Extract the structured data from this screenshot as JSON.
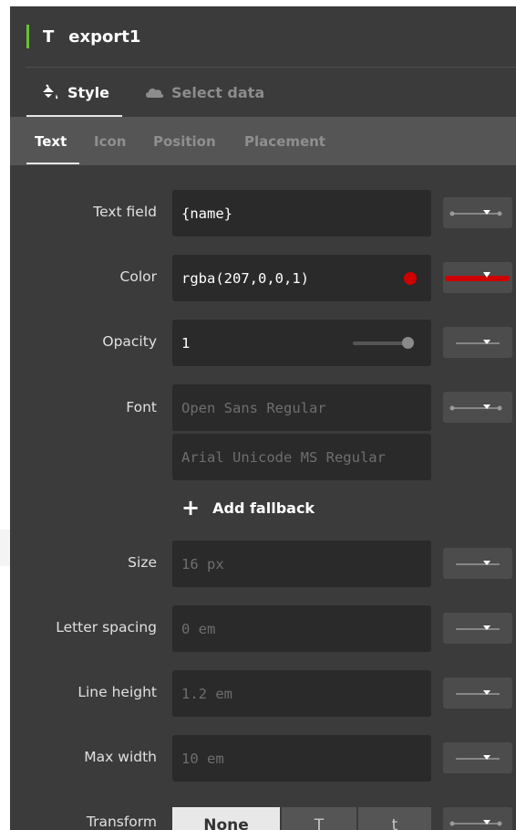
{
  "layer": {
    "type_icon": "T",
    "name": "export1",
    "accent_color": "#67c23a"
  },
  "main_tabs": [
    {
      "label": "Style",
      "icon": "paint-bucket-icon",
      "active": true
    },
    {
      "label": "Select data",
      "icon": "cloud-icon",
      "active": false
    }
  ],
  "sub_tabs": [
    {
      "label": "Text",
      "active": true
    },
    {
      "label": "Icon",
      "active": false
    },
    {
      "label": "Position",
      "active": false
    },
    {
      "label": "Placement",
      "active": false
    }
  ],
  "properties": {
    "text_field": {
      "label": "Text field",
      "value": "{name}"
    },
    "color": {
      "label": "Color",
      "value": "rgba(207,0,0,1)",
      "swatch": "#cf0000"
    },
    "opacity": {
      "label": "Opacity",
      "value": "1"
    },
    "font": {
      "label": "Font",
      "primary": "Open Sans Regular",
      "fallback": "Arial Unicode MS Regular",
      "add_label": "Add fallback"
    },
    "size": {
      "label": "Size",
      "value": "16 px"
    },
    "letter_spacing": {
      "label": "Letter spacing",
      "value": "0 em"
    },
    "line_height": {
      "label": "Line height",
      "value": "1.2 em"
    },
    "max_width": {
      "label": "Max width",
      "value": "10 em"
    },
    "transform": {
      "label": "Transform",
      "options": [
        "None",
        "T",
        "t"
      ],
      "selected": "None"
    }
  },
  "zoom_button_icon": "zoom-function-icon"
}
